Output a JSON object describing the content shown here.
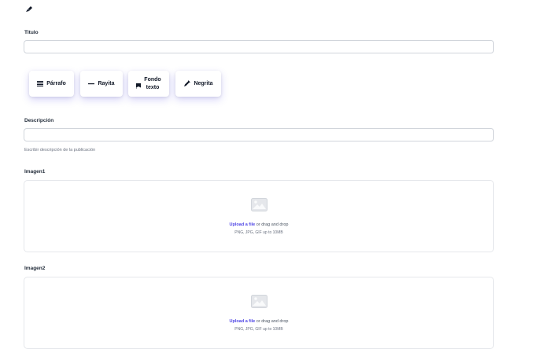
{
  "header": {
    "logo_icon": "pen-nib-icon"
  },
  "titulo": {
    "label": "Titulo",
    "value": "",
    "placeholder": ""
  },
  "toolbar": {
    "buttons": [
      {
        "label": "Párrafo",
        "icon": "paragraph-lines-icon"
      },
      {
        "label": "Rayita",
        "icon": "dash-icon"
      },
      {
        "label_line1": "Fondo",
        "label_line2": "texto",
        "icon": "bookmark-icon"
      },
      {
        "label": "Negrita",
        "icon": "pen-icon"
      }
    ]
  },
  "descripcion": {
    "label": "Descripción",
    "value": "",
    "placeholder": "",
    "help": "Escribir descripción de la publicación"
  },
  "imagen1": {
    "label": "Imagen1",
    "upload_link": "Upload a file",
    "drag_text": " or drag and drop",
    "formats": "PNG, JPG, GIF up to 10MB",
    "icon": "image-icon"
  },
  "imagen2": {
    "label": "Imagen2",
    "upload_link": "Upload a file",
    "drag_text": " or drag and drop",
    "formats": "PNG, JPG, GIF up to 10MB",
    "icon": "image-icon"
  },
  "colors": {
    "accent": "#4f46e5",
    "border": "#d1d5db",
    "text": "#1f2937"
  }
}
